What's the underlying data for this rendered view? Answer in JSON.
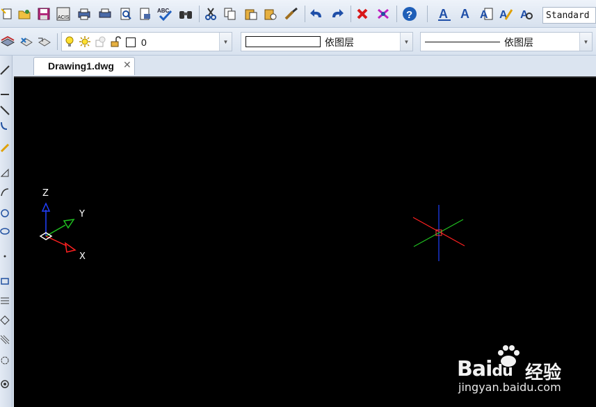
{
  "toolbar1": {
    "icons": [
      "new-icon",
      "open-icon",
      "save-icon",
      "acis-icon",
      "plot-icon",
      "print-icon",
      "print-preview-icon",
      "publish-icon",
      "spellcheck-icon",
      "find-icon",
      "cut-icon",
      "copy-icon",
      "paste-icon",
      "paste-special-icon",
      "match-properties-icon",
      "undo-icon",
      "redo-icon",
      "delete-icon",
      "purge-icon",
      "help-icon",
      "text-style-icon",
      "text-icon",
      "multiline-text-icon",
      "edit-text-icon",
      "find-text-icon"
    ],
    "text_style": "Standard",
    "spellcheck_label": "ABC",
    "acis_label": "ACIS"
  },
  "toolbar2": {
    "layer_name": "0",
    "color_label": "依图层",
    "linetype_label": "依图层"
  },
  "tab": {
    "title": "Drawing1.dwg",
    "close": "✕"
  },
  "canvas": {
    "background": "#000000",
    "axis_labels": {
      "x": "X",
      "y": "Y",
      "z": "Z"
    },
    "axis_colors": {
      "x": "#ff2020",
      "y": "#20c020",
      "z": "#2040ff"
    }
  },
  "watermark": {
    "brand": "Bai",
    "paw": "du",
    "cn": "经验",
    "url": "jingyan.baidu.com"
  }
}
